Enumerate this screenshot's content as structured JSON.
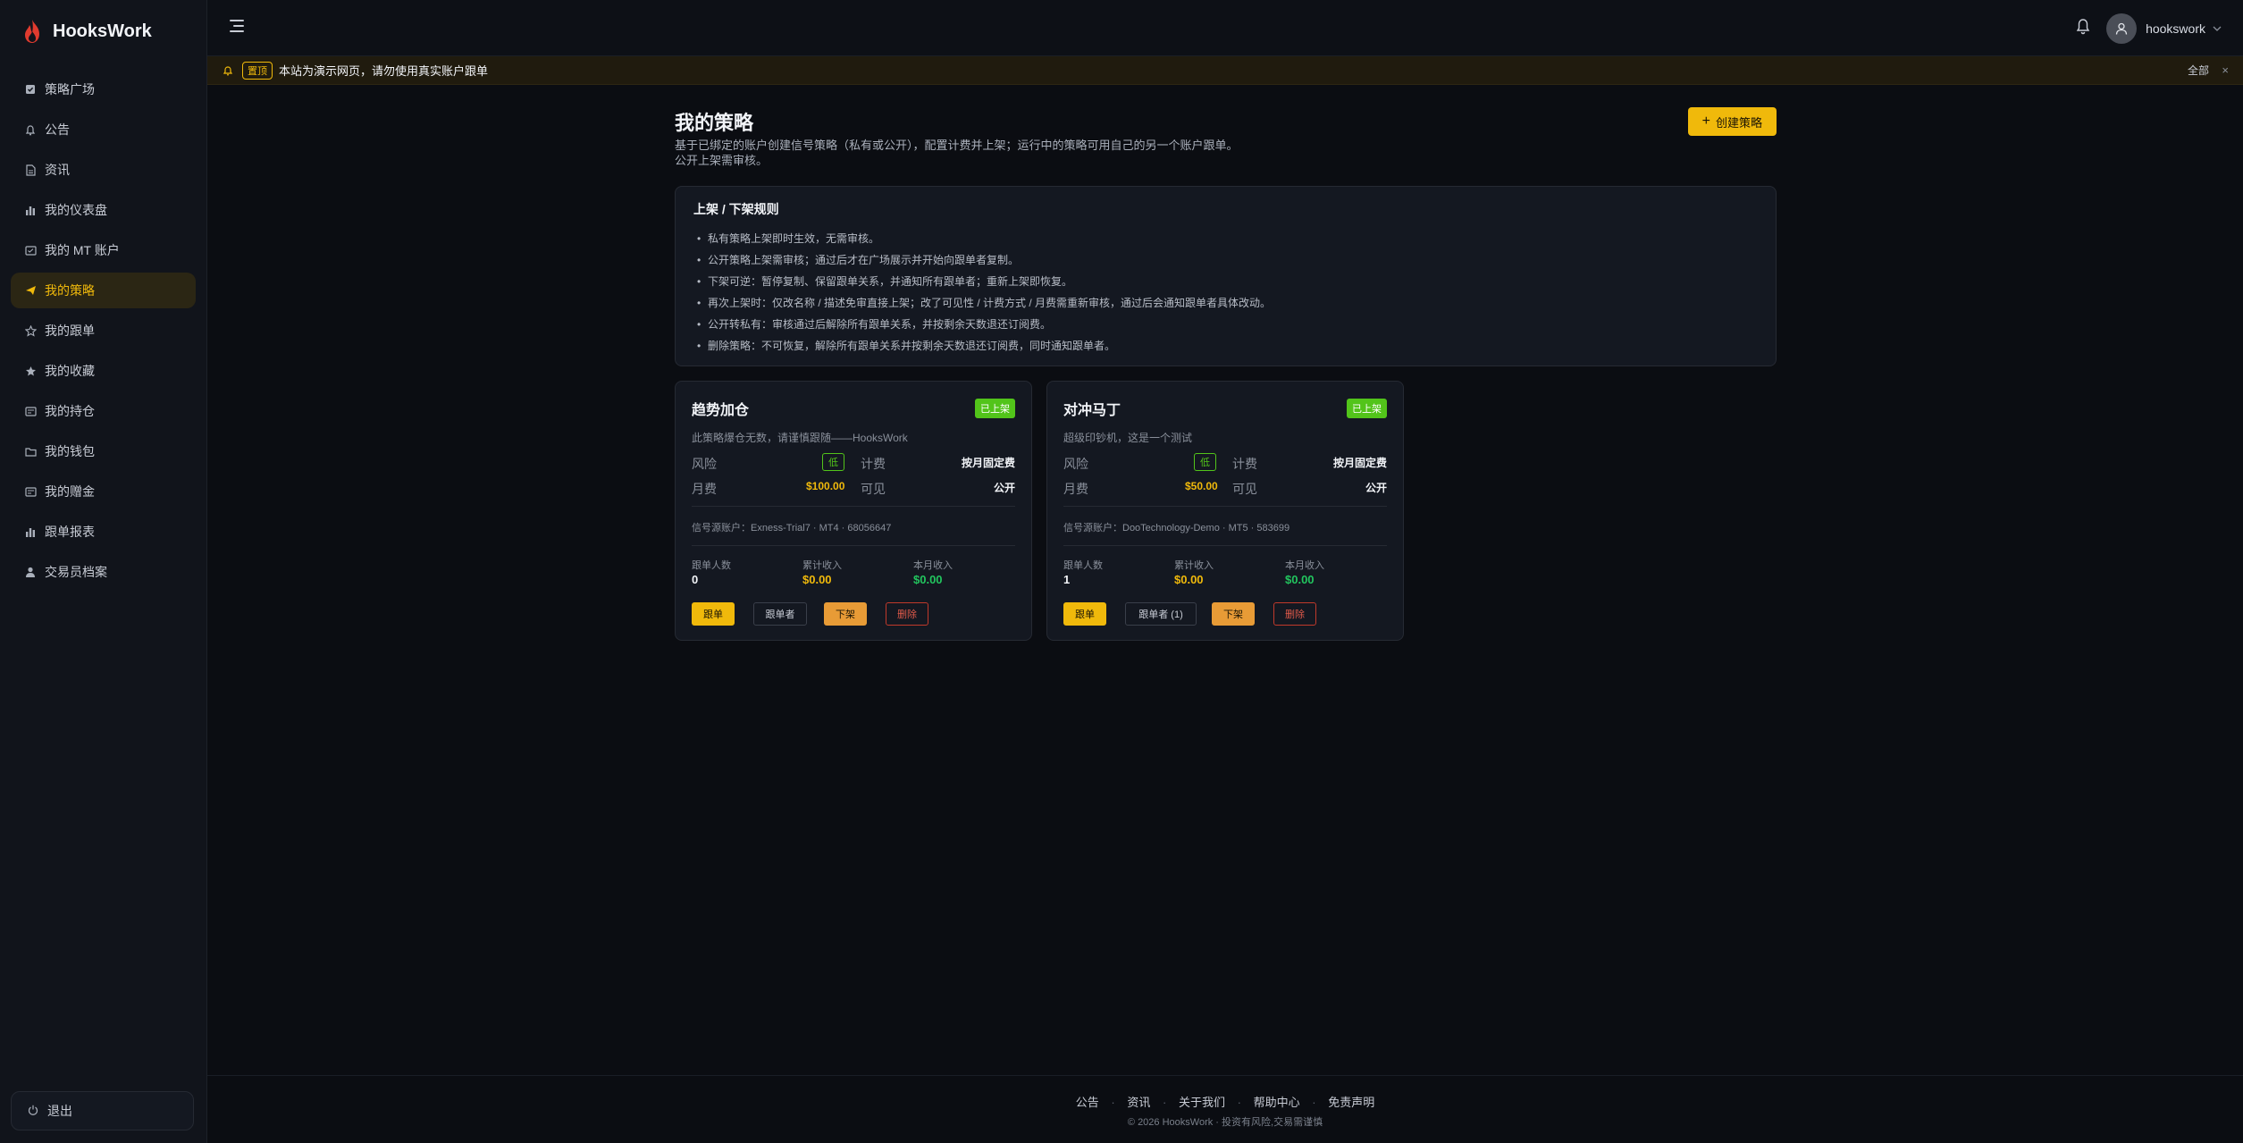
{
  "app": {
    "name": "HooksWork"
  },
  "sidebar": {
    "items": [
      {
        "label": "策略广场",
        "icon": "clipboard-check-icon"
      },
      {
        "label": "公告",
        "icon": "bell-icon"
      },
      {
        "label": "资讯",
        "icon": "file-icon"
      },
      {
        "label": "我的仪表盘",
        "icon": "bar-chart-icon"
      },
      {
        "label": "我的 MT 账户",
        "icon": "account-card-icon"
      },
      {
        "label": "我的策略",
        "icon": "send-icon",
        "active": true
      },
      {
        "label": "我的跟单",
        "icon": "star-outline-icon"
      },
      {
        "label": "我的收藏",
        "icon": "star-filled-icon"
      },
      {
        "label": "我的持仓",
        "icon": "receipt-icon"
      },
      {
        "label": "我的钱包",
        "icon": "folder-icon"
      },
      {
        "label": "我的赠金",
        "icon": "receipt-icon"
      },
      {
        "label": "跟单报表",
        "icon": "bar-chart-icon"
      },
      {
        "label": "交易员档案",
        "icon": "user-icon"
      }
    ],
    "logout_label": "退出"
  },
  "topbar": {
    "username": "hookswork"
  },
  "notice": {
    "tag": "置顶",
    "text": "本站为演示网页，请勿使用真实账户跟单",
    "all_label": "全部",
    "close_label": "×"
  },
  "page": {
    "title": "我的策略",
    "desc_line1": "基于已绑定的账户创建信号策略（私有或公开），配置计费并上架；运行中的策略可用自己的另一个账户跟单。",
    "desc_line2": "公开上架需审核。",
    "create_label": "创建策略"
  },
  "rules": {
    "title": "上架 / 下架规则",
    "items": [
      "私有策略上架即时生效，无需审核。",
      "公开策略上架需审核；通过后才在广场展示并开始向跟单者复制。",
      "下架可逆：暂停复制、保留跟单关系，并通知所有跟单者；重新上架即恢复。",
      "再次上架时：仅改名称 / 描述免审直接上架；改了可见性 / 计费方式 / 月费需重新审核，通过后会通知跟单者具体改动。",
      "公开转私有：审核通过后解除所有跟单关系，并按剩余天数退还订阅费。",
      "删除策略：不可恢复，解除所有跟单关系并按剩余天数退还订阅费，同时通知跟单者。"
    ]
  },
  "labels": {
    "risk": "风险",
    "billing": "计费",
    "monthly_fee": "月费",
    "visibility": "可见",
    "followers_count": "跟单人数",
    "total_income": "累计收入",
    "month_income": "本月收入",
    "follow_btn": "跟单",
    "off_btn": "下架",
    "delete_btn": "删除"
  },
  "strategies": [
    {
      "name": "趋势加仓",
      "status": "已上架",
      "desc": "此策略爆仓无数，请谨慎跟随——HooksWork",
      "risk": "低",
      "billing": "按月固定费",
      "fee": "$100.00",
      "visibility": "公开",
      "source": "信号源账户：Exness-Trial7 · MT4 · 68056647",
      "followers": "0",
      "total_income": "$0.00",
      "month_income": "$0.00",
      "followers_btn": "跟单者"
    },
    {
      "name": "对冲马丁",
      "status": "已上架",
      "desc": "超级印钞机，这是一个测试",
      "risk": "低",
      "billing": "按月固定费",
      "fee": "$50.00",
      "visibility": "公开",
      "source": "信号源账户：DooTechnology-Demo · MT5 · 583699",
      "followers": "1",
      "total_income": "$0.00",
      "month_income": "$0.00",
      "followers_btn": "跟单者 (1)"
    }
  ],
  "footer": {
    "links": [
      "公告",
      "资讯",
      "关于我们",
      "帮助中心",
      "免责声明"
    ],
    "copyright": "© 2026 HooksWork · 投资有风险,交易需谨慎"
  },
  "colors": {
    "accent": "#f0b90b",
    "success": "#52c41a",
    "danger": "#e05a4a",
    "income": "#22c55e"
  }
}
